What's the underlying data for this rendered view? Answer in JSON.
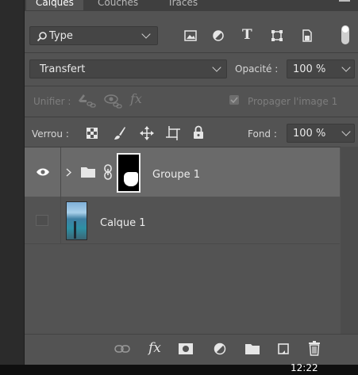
{
  "tabs": [
    "Calques",
    "Couches",
    "Tracés"
  ],
  "filter": {
    "label": "Type"
  },
  "blend": {
    "mode": "Transfert",
    "opacity_label": "Opacité :",
    "opacity_value": "100 %"
  },
  "unify": {
    "label": "Unifier :",
    "propagate_label": "Propager l'image 1"
  },
  "lock": {
    "label": "Verrou :",
    "fill_label": "Fond :",
    "fill_value": "100 %"
  },
  "layers": [
    {
      "name": "Groupe 1",
      "type": "group",
      "visible": true,
      "selected": true
    },
    {
      "name": "Calque 1",
      "type": "pixel",
      "visible": false,
      "selected": false
    }
  ],
  "footer_icons": [
    "link-icon",
    "fx-icon",
    "mask-icon",
    "adjustment-icon",
    "folder-icon",
    "new-layer-icon",
    "trash-icon"
  ],
  "taskbar": {
    "time": "12:22"
  },
  "colors": {
    "panel": "#535353",
    "selected_row": "#6a6a6a",
    "field": "#454545"
  }
}
